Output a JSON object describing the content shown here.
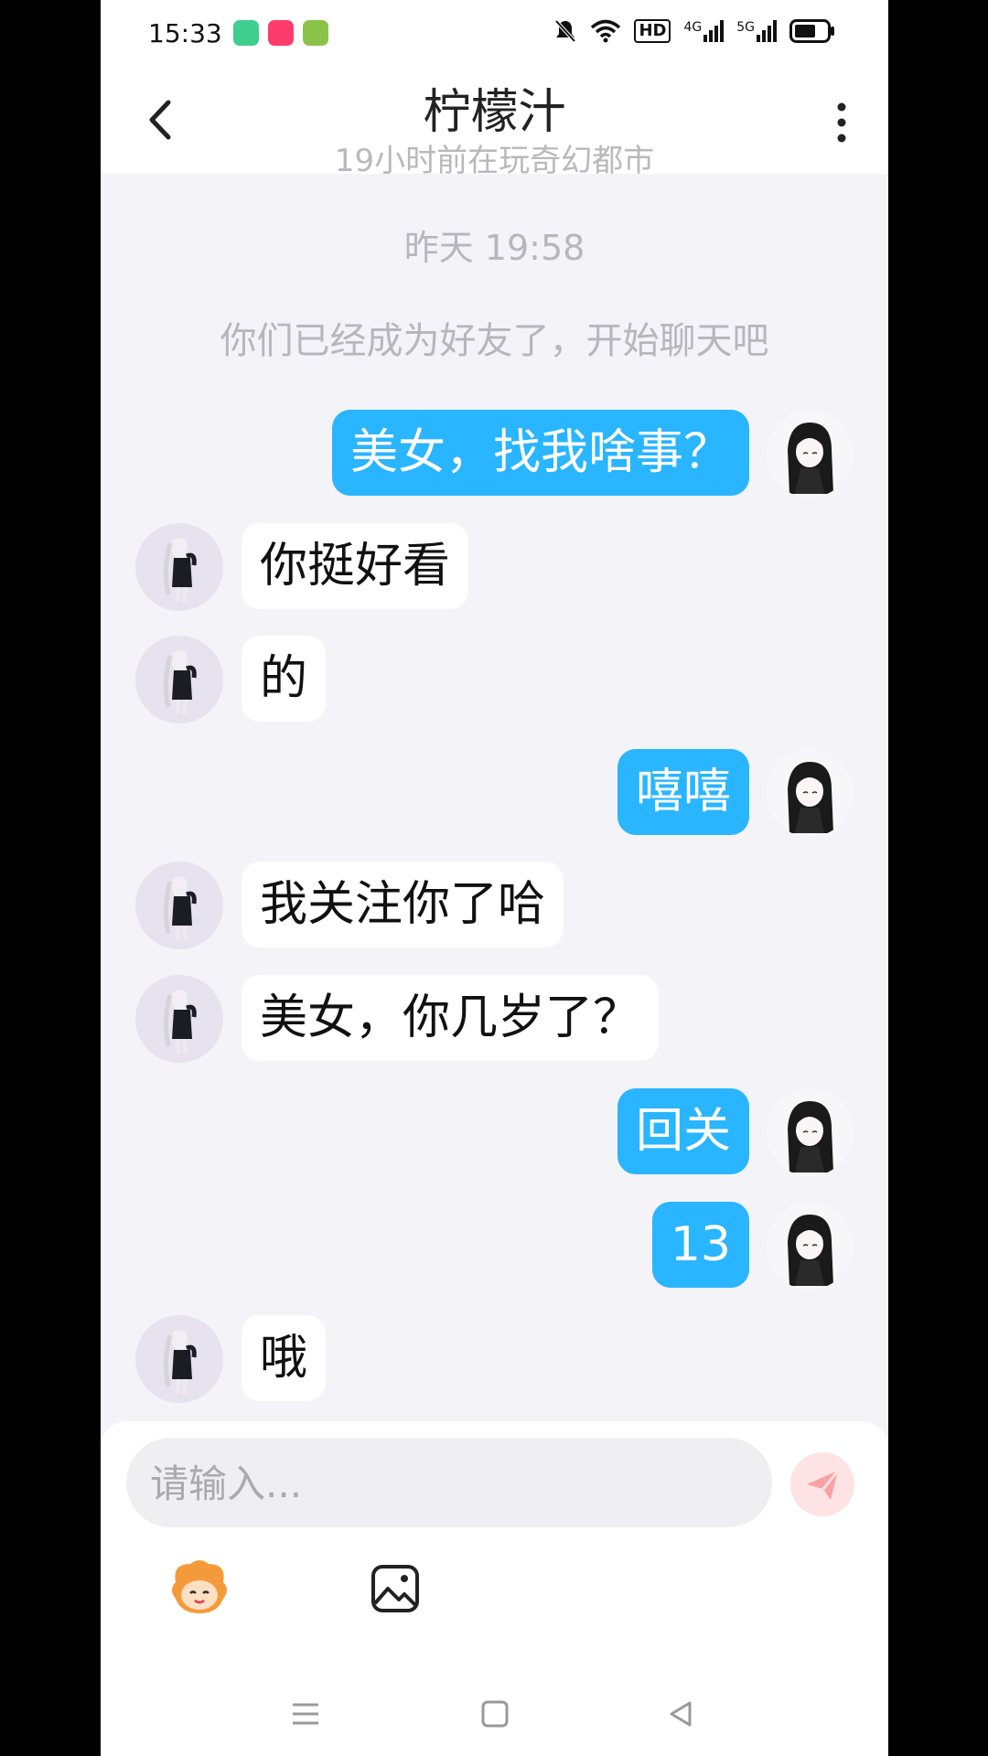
{
  "status_bar": {
    "time": "15:33",
    "hd_label": "HD",
    "net1": "4G",
    "net2": "5G"
  },
  "nav": {
    "title": "柠檬汁",
    "subtitle": "19小时前在玩奇幻都市"
  },
  "chat": {
    "time_divider": "昨天 19:58",
    "system_tip": "你们已经成为好友了，开始聊天吧",
    "messages": [
      {
        "side": "out",
        "text": "美女，找我啥事？"
      },
      {
        "side": "in",
        "text": "你挺好看"
      },
      {
        "side": "in",
        "text": "的"
      },
      {
        "side": "out",
        "text": "嘻嘻"
      },
      {
        "side": "in",
        "text": "我关注你了哈"
      },
      {
        "side": "in",
        "text": "美女，你几岁了？"
      },
      {
        "side": "out",
        "text": "回关"
      },
      {
        "side": "out",
        "text": "13"
      },
      {
        "side": "in",
        "text": "哦"
      }
    ]
  },
  "composer": {
    "placeholder": "请输入..."
  },
  "colors": {
    "outgoing_bubble": "#29b5ff",
    "send_button": "#fde3e3",
    "send_icon": "#f6a3a3"
  },
  "icons": [
    "back-chevron-icon",
    "more-vertical-icon",
    "send-icon",
    "emoji-avatar-icon",
    "image-icon",
    "menu-icon",
    "home-icon",
    "back-triangle-icon"
  ]
}
